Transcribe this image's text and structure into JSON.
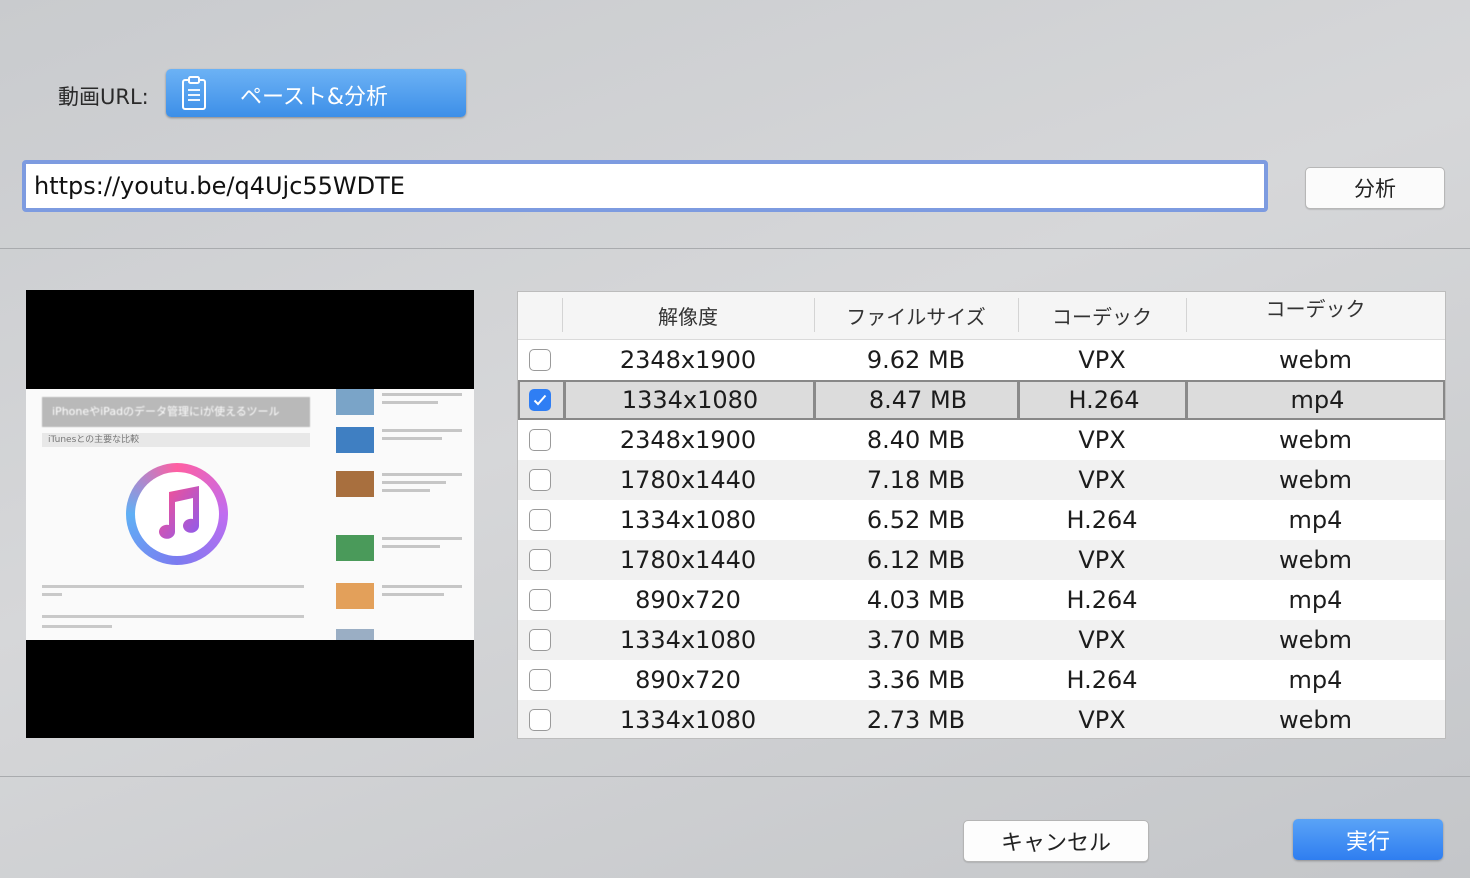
{
  "url_label": "動画URL:",
  "paste_button": {
    "label": "ペースト&分析",
    "icon": "clipboard-icon"
  },
  "url_input": {
    "value": "https://youtu.be/q4Ujc55WDTE"
  },
  "analyze_button": {
    "label": "分析"
  },
  "preview": {
    "header_text": "iPhoneやiPadのデータ管理にiが使えるツール",
    "sub_text": "iTunesとの主要な比較"
  },
  "table": {
    "columns": [
      "",
      "解像度",
      "ファイルサイズ",
      "コーデック",
      "コーデック"
    ],
    "rows": [
      {
        "checked": false,
        "resolution": "2348x1900",
        "size": "9.62 MB",
        "codec": "VPX",
        "container": "webm"
      },
      {
        "checked": true,
        "resolution": "1334x1080",
        "size": "8.47 MB",
        "codec": "H.264",
        "container": "mp4"
      },
      {
        "checked": false,
        "resolution": "2348x1900",
        "size": "8.40 MB",
        "codec": "VPX",
        "container": "webm"
      },
      {
        "checked": false,
        "resolution": "1780x1440",
        "size": "7.18 MB",
        "codec": "VPX",
        "container": "webm"
      },
      {
        "checked": false,
        "resolution": "1334x1080",
        "size": "6.52 MB",
        "codec": "H.264",
        "container": "mp4"
      },
      {
        "checked": false,
        "resolution": "1780x1440",
        "size": "6.12 MB",
        "codec": "VPX",
        "container": "webm"
      },
      {
        "checked": false,
        "resolution": "890x720",
        "size": "4.03 MB",
        "codec": "H.264",
        "container": "mp4"
      },
      {
        "checked": false,
        "resolution": "1334x1080",
        "size": "3.70 MB",
        "codec": "VPX",
        "container": "webm"
      },
      {
        "checked": false,
        "resolution": "890x720",
        "size": "3.36 MB",
        "codec": "H.264",
        "container": "mp4"
      },
      {
        "checked": false,
        "resolution": "1334x1080",
        "size": "2.73 MB",
        "codec": "VPX",
        "container": "webm"
      }
    ]
  },
  "cancel_button": {
    "label": "キャンセル"
  },
  "run_button": {
    "label": "実行"
  },
  "colors": {
    "accent": "#3d8fe8",
    "focus_ring": "#7d9be0",
    "checkbox_on": "#2f7ef4"
  }
}
